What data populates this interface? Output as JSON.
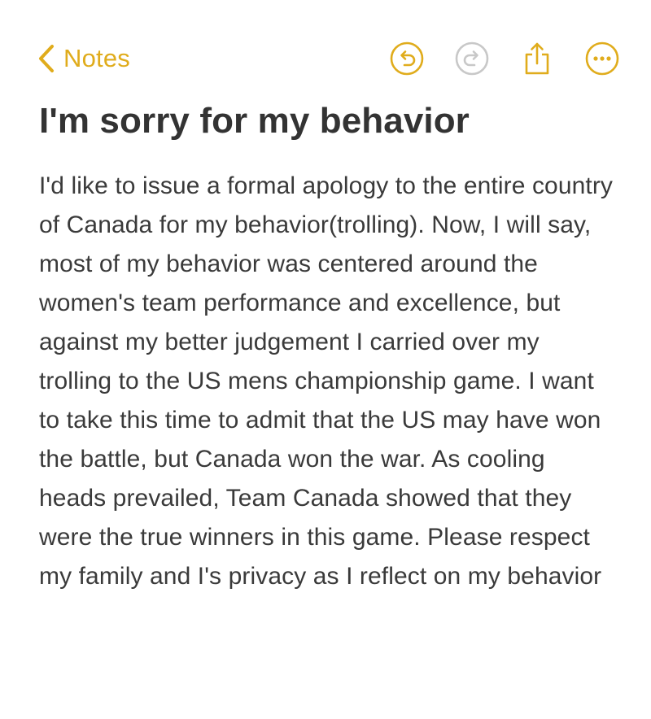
{
  "nav": {
    "back_label": "Notes",
    "accent_color": "#e0ac1c",
    "disabled_color": "#c8c8c8"
  },
  "toolbar": {
    "icons": [
      "undo-icon",
      "redo-icon",
      "share-icon",
      "more-icon"
    ],
    "redo_enabled": false
  },
  "note": {
    "title": "I'm sorry for my behavior",
    "body": "I'd like to issue a formal apology to the entire country of Canada for my behavior(trolling). Now, I will say, most of my behavior was centered around the women's team performance and excellence, but against my better judgement I carried over my trolling to the US mens championship game. I want to take this time to admit that the US may have won the battle, but Canada won the war. As cooling heads prevailed, Team Canada showed that they were the true winners in this game. Please respect my family and I's privacy as I reflect on my behavior"
  }
}
